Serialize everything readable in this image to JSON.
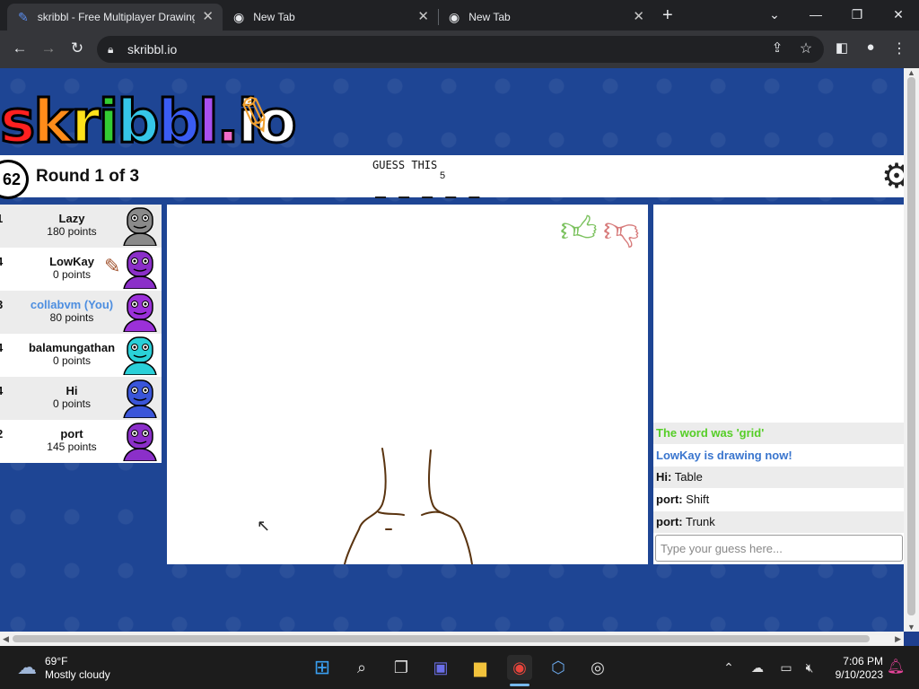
{
  "browser": {
    "tabs": [
      {
        "title": "skribbl - Free Multiplayer Drawing",
        "active": true
      },
      {
        "title": "New Tab",
        "active": false
      },
      {
        "title": "New Tab",
        "active": false
      }
    ],
    "new_tab": "+",
    "url": "skribbl.io"
  },
  "game": {
    "logo_letters": [
      "s",
      "k",
      "r",
      "i",
      "b",
      "b",
      "l",
      ".",
      "i",
      "o"
    ],
    "logo_colors": [
      "#ff2020",
      "#ff8c1a",
      "#ffe11a",
      "#33cc33",
      "#35c6e8",
      "#3a5cf2",
      "#a84ff0",
      "#f06bc8",
      "#ffffff",
      "#ffffff"
    ],
    "timer": "62",
    "round": "Round 1 of 3",
    "guess_title": "GUESS THIS",
    "word_hint": "_ _ _ _ _",
    "word_length": "5",
    "players": [
      {
        "rank": "1",
        "name": "Lazy",
        "points": "180 points",
        "avatar_color": "#8a8a8a",
        "drawing": false,
        "you": false
      },
      {
        "rank": "4",
        "name": "LowKay",
        "points": "0 points",
        "avatar_color": "#8b2fc9",
        "drawing": true,
        "you": false
      },
      {
        "rank": "3",
        "name": "collabvm (You)",
        "points": "80 points",
        "avatar_color": "#9b30d9",
        "drawing": false,
        "you": true
      },
      {
        "rank": "4",
        "name": "balamungathan",
        "points": "0 points",
        "avatar_color": "#2ad0d8",
        "drawing": false,
        "you": false
      },
      {
        "rank": "4",
        "name": "Hi",
        "points": "0 points",
        "avatar_color": "#3a55d9",
        "drawing": false,
        "you": false
      },
      {
        "rank": "2",
        "name": "port",
        "points": "145 points",
        "avatar_color": "#8b2fc9",
        "drawing": false,
        "you": false
      }
    ],
    "chat": [
      {
        "user": "",
        "text": "The word was 'grid'",
        "color": "#56ce27",
        "bold": true
      },
      {
        "user": "",
        "text": "LowKay is drawing now!",
        "color": "#3975ce",
        "bold": true
      },
      {
        "user": "Hi:",
        "text": "Table",
        "color": "#111111",
        "bold": false
      },
      {
        "user": "port:",
        "text": "Shift",
        "color": "#111111",
        "bold": false
      },
      {
        "user": "port:",
        "text": "Trunk",
        "color": "#111111",
        "bold": false
      }
    ],
    "guess_placeholder": "Type your guess here..."
  },
  "taskbar": {
    "temperature": "69°F",
    "weather": "Mostly cloudy",
    "time": "7:06 PM",
    "date": "9/10/2023"
  }
}
